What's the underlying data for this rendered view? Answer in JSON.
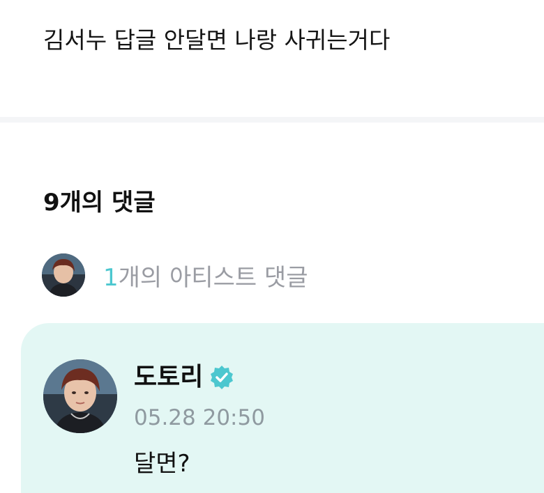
{
  "post": {
    "body": "김서누 답글 안달면 나랑 사귀는거다"
  },
  "comments": {
    "count_label": "9개의 댓글",
    "artist_summary": {
      "count": "1",
      "label": "개의 아티스트 댓글"
    },
    "items": [
      {
        "author": "도토리",
        "verified_icon": "verified-badge-icon",
        "timestamp": "05.28 20:50",
        "text": "달면?"
      }
    ]
  },
  "colors": {
    "accent": "#4cc7cf",
    "comment_card_bg": "#e3f7f4",
    "muted_text": "#9a9ca3",
    "divider": "#f4f5f7"
  }
}
